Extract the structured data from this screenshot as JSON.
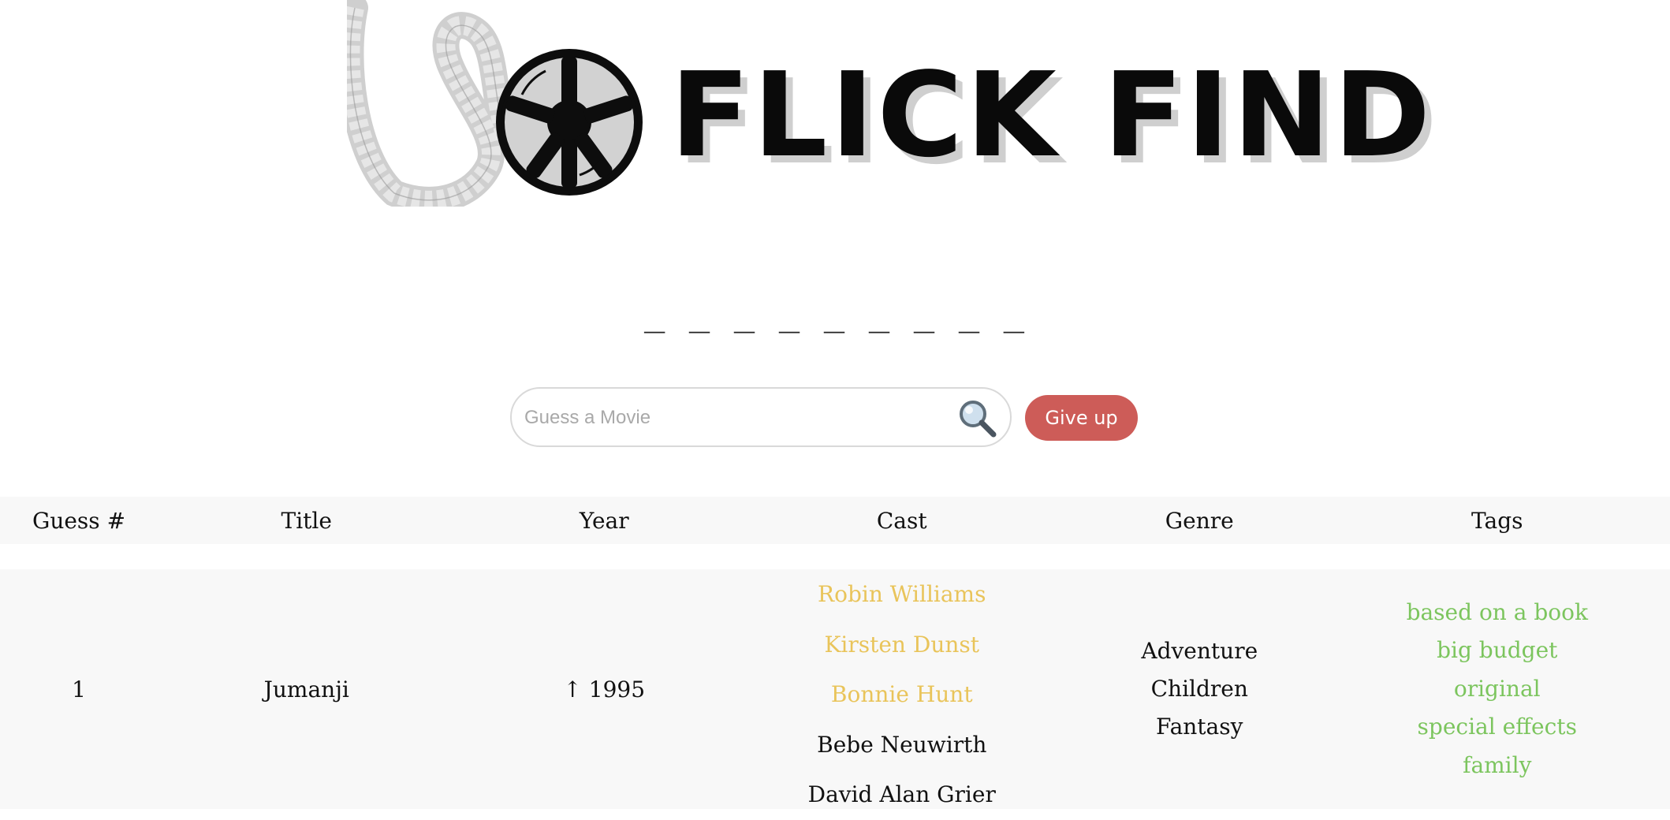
{
  "app": {
    "logo_text": "FLICK FIND"
  },
  "hint": {
    "blanks": "_ _ _ _ _   _ _ _   _"
  },
  "search": {
    "placeholder": "Guess a Movie",
    "value": "",
    "icon": "magnifier-icon"
  },
  "give_up_label": "Give up",
  "colors": {
    "give_up": "#cd5c58",
    "partial_match": "#e9c45a",
    "exact_match": "#7cc55e",
    "header_bg": "#f8f8f8"
  },
  "table": {
    "headers": [
      "Guess #",
      "Title",
      "Year",
      "Cast",
      "Genre",
      "Tags"
    ],
    "rows": [
      {
        "guess_number": "1",
        "title": "Jumanji",
        "year": "↑ 1995",
        "cast": [
          {
            "name": "Robin Williams",
            "match": "partial"
          },
          {
            "name": "Kirsten Dunst",
            "match": "partial"
          },
          {
            "name": "Bonnie Hunt",
            "match": "partial"
          },
          {
            "name": "Bebe Neuwirth",
            "match": "none"
          },
          {
            "name": "David Alan Grier",
            "match": "none"
          }
        ],
        "genres": [
          {
            "name": "Adventure",
            "match": "none"
          },
          {
            "name": "Children",
            "match": "none"
          },
          {
            "name": "Fantasy",
            "match": "none"
          }
        ],
        "tags": [
          {
            "name": "based on a book",
            "match": "exact"
          },
          {
            "name": "big budget",
            "match": "exact"
          },
          {
            "name": "original",
            "match": "exact"
          },
          {
            "name": "special effects",
            "match": "exact"
          },
          {
            "name": "family",
            "match": "exact"
          }
        ]
      }
    ]
  }
}
